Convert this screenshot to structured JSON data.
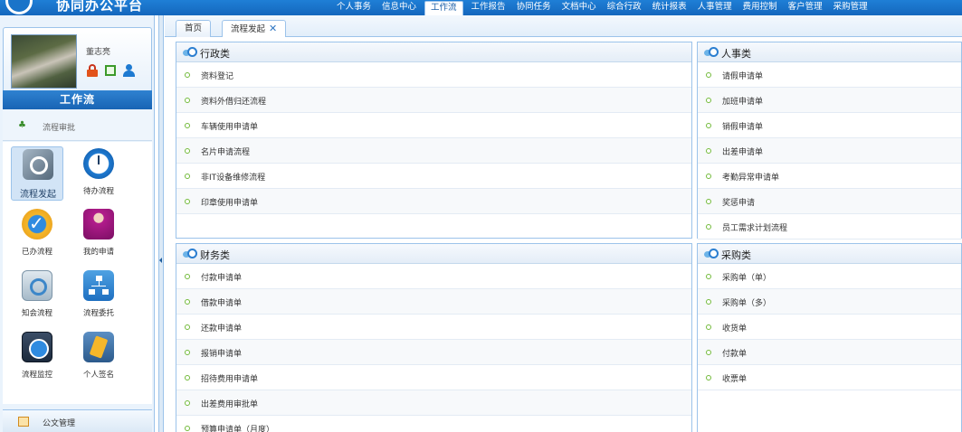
{
  "topbar": {
    "logo_text": "协同办公平台",
    "nav": [
      "个人事务",
      "信息中心",
      "工作流",
      "工作报告",
      "协同任务",
      "文档中心",
      "综合行政",
      "统计报表",
      "人事管理",
      "费用控制",
      "客户管理",
      "采购管理"
    ],
    "active_nav": "工作流"
  },
  "user": {
    "name": "董志亮"
  },
  "sidebar": {
    "section_title": "工作流",
    "sub_item": "流程审批",
    "tiles": [
      {
        "label": "流程发起",
        "icon": "process-start-icon",
        "selected": true
      },
      {
        "label": "待办流程",
        "icon": "clock-icon",
        "selected": false
      },
      {
        "label": "已办流程",
        "icon": "check-circle-icon",
        "selected": false
      },
      {
        "label": "我的申请",
        "icon": "person-icon",
        "selected": false
      },
      {
        "label": "知会流程",
        "icon": "magnifier-icon",
        "selected": false
      },
      {
        "label": "流程委托",
        "icon": "org-chart-icon",
        "selected": false
      },
      {
        "label": "流程监控",
        "icon": "monitor-icon",
        "selected": false
      },
      {
        "label": "个人签名",
        "icon": "signature-icon",
        "selected": false
      }
    ],
    "bottom_item": "公文管理"
  },
  "tabs": {
    "home": "首页",
    "active": "流程发起",
    "close": "✕"
  },
  "panels": {
    "admin": {
      "title": "行政类",
      "items": [
        "资料登记",
        "资料外借归还流程",
        "车辆使用申请单",
        "名片申请流程",
        "非IT设备维修流程",
        "印章使用申请单"
      ]
    },
    "hr": {
      "title": "人事类",
      "items": [
        "请假申请单",
        "加班申请单",
        "销假申请单",
        "出差申请单",
        "考勤异常申请单",
        "奖惩申请",
        "员工需求计划流程"
      ]
    },
    "finance": {
      "title": "财务类",
      "items": [
        "付款申请单",
        "借款申请单",
        "还款申请单",
        "报销申请单",
        "招待费用申请单",
        "出差费用审批单",
        "预算申请单（月度）"
      ]
    },
    "purchase": {
      "title": "采购类",
      "items": [
        "采购单（单）",
        "采购单（多）",
        "收货单",
        "付款单",
        "收票单"
      ]
    }
  }
}
